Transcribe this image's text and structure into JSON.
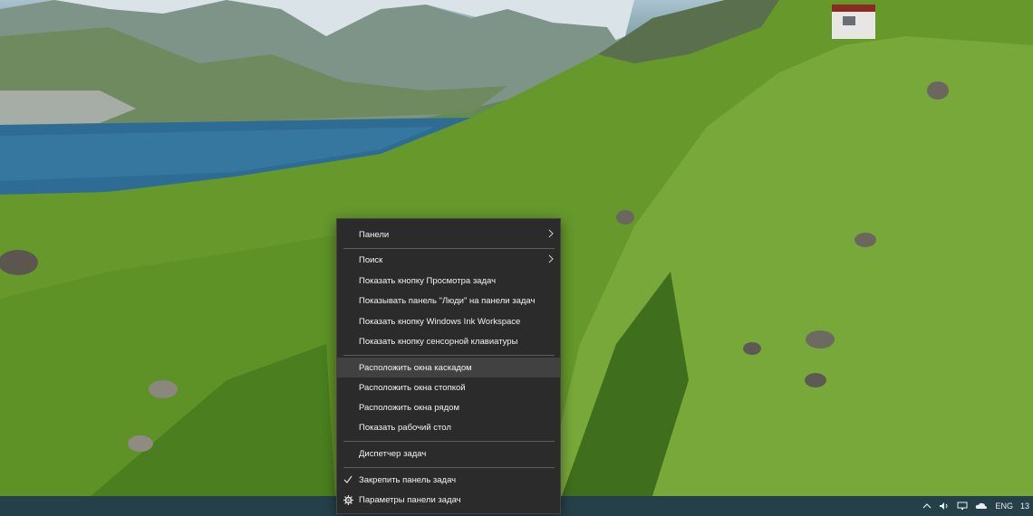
{
  "context_menu": {
    "items": [
      {
        "label": "Панели"
      },
      {
        "label": "Поиск"
      },
      {
        "label": "Показать кнопку Просмотра задач"
      },
      {
        "label": "Показывать панель \"Люди\" на панели задач"
      },
      {
        "label": "Показать кнопку Windows Ink Workspace"
      },
      {
        "label": "Показать кнопку сенсорной клавиатуры"
      },
      {
        "label": "Расположить окна каскадом"
      },
      {
        "label": "Расположить окна стопкой"
      },
      {
        "label": "Расположить окна рядом"
      },
      {
        "label": "Показать рабочий стол"
      },
      {
        "label": "Диспетчер задач"
      },
      {
        "label": "Закрепить панель задач"
      },
      {
        "label": "Параметры панели задач"
      }
    ],
    "hovered_item": "Расположить окна каскадом",
    "checked_item": "Закрепить панель задач"
  },
  "taskbar": {
    "language": "ENG",
    "clock_partial": "13"
  },
  "colors": {
    "menu_bg": "#2b2b2b",
    "menu_hover": "#414141",
    "taskbar": "#26404a"
  },
  "icons": [
    "chevron-up-icon",
    "volume-icon",
    "network-icon",
    "onedrive-cloud-icon",
    "submenu-arrow-icon",
    "checkmark-icon",
    "gear-icon"
  ]
}
